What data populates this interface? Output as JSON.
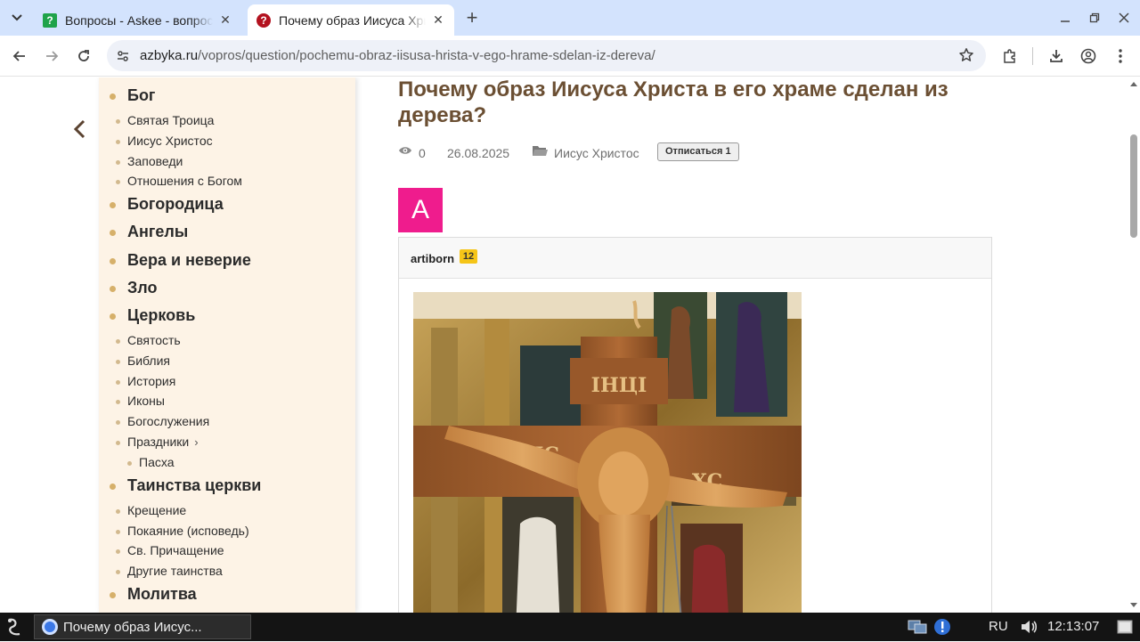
{
  "browser": {
    "tabs": [
      {
        "title": "Вопросы - Askee - вопросы и ответы",
        "favicon": "askee-icon",
        "active": false
      },
      {
        "title": "Почему образ Иисуса Христа в его храме сделан из дерева?",
        "favicon": "question-icon",
        "active": true
      }
    ],
    "url_host": "azbyka.ru",
    "url_path": "/vopros/question/pochemu-obraz-iisusa-hrista-v-ego-hrame-sdelan-iz-dereva/"
  },
  "sidebar": {
    "items": [
      {
        "label": "Бог",
        "level": "main"
      },
      {
        "label": "Святая Троица",
        "level": "sub"
      },
      {
        "label": "Иисус Христос",
        "level": "sub"
      },
      {
        "label": "Заповеди",
        "level": "sub"
      },
      {
        "label": "Отношения с Богом",
        "level": "sub"
      },
      {
        "label": "Богородица",
        "level": "main"
      },
      {
        "label": "Ангелы",
        "level": "main"
      },
      {
        "label": "Вера и неверие",
        "level": "main"
      },
      {
        "label": "Зло",
        "level": "main"
      },
      {
        "label": "Церковь",
        "level": "main"
      },
      {
        "label": "Святость",
        "level": "sub"
      },
      {
        "label": "Библия",
        "level": "sub"
      },
      {
        "label": "История",
        "level": "sub"
      },
      {
        "label": "Иконы",
        "level": "sub"
      },
      {
        "label": "Богослужения",
        "level": "sub"
      },
      {
        "label": "Праздники",
        "level": "sub",
        "has_arrow": true
      },
      {
        "label": "Пасха",
        "level": "subsub"
      },
      {
        "label": "Таинства церкви",
        "level": "main"
      },
      {
        "label": "Крещение",
        "level": "sub"
      },
      {
        "label": "Покаяние (исповедь)",
        "level": "sub"
      },
      {
        "label": "Св. Причащение",
        "level": "sub"
      },
      {
        "label": "Другие таинства",
        "level": "sub"
      },
      {
        "label": "Молитва",
        "level": "main"
      }
    ]
  },
  "article": {
    "title": "Почему образ Иисуса Христа в его храме сделан из дерева?",
    "views": "0",
    "date": "26.08.2025",
    "category": "Иисус Христос",
    "unsubscribe_label": "Отписаться 1",
    "avatar_letter": "A",
    "author": "artiborn",
    "reputation": "12"
  },
  "taskbar": {
    "window_title": "Почему образ Иисус...",
    "language": "RU",
    "time": "12:13:07"
  },
  "colors": {
    "accent_title": "#6b4f33",
    "avatar_bg": "#ef1c8d",
    "sidebar_bg": "#fdf3e6",
    "reputation_badge": "#f5c518"
  }
}
